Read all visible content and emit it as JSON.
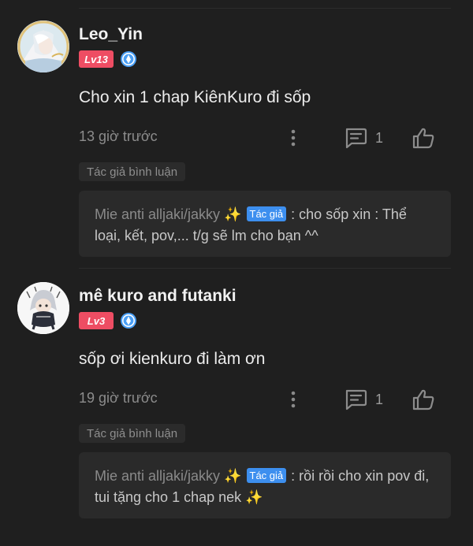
{
  "comments": [
    {
      "username": "Leo_Yin",
      "level": "Lv13",
      "text": "Cho xin 1 chap KiênKuro đi sốp",
      "time": "13 giờ trước",
      "reply_count": "1",
      "author_tag": "Tác giả bình luận",
      "reply": {
        "author": "Mie anti alljaki/jakky",
        "sparkle": "✨",
        "tag": "Tác giả",
        "text": ": cho sốp xin : Thể loại, kết, pov,... t/g sẽ lm cho bạn ^^",
        "trailing": ""
      }
    },
    {
      "username": "mê kuro and futanki",
      "level": "Lv3",
      "text": "sốp ơi kienkuro đi làm ơn",
      "time": "19 giờ trước",
      "reply_count": "1",
      "author_tag": "Tác giả bình luận",
      "reply": {
        "author": "Mie anti alljaki/jakky",
        "sparkle": "✨",
        "tag": "Tác giả",
        "text": ": rồi rồi cho xin pov đi, tui tặng cho 1 chap nek",
        "trailing": "✨"
      }
    }
  ],
  "icons": {
    "more": "more-vertical-icon",
    "reply": "comment-icon",
    "like": "thumbs-up-icon",
    "verify": "verified-badge-icon"
  },
  "colors": {
    "background": "#1f1f1f",
    "level_badge": "#ee4d63",
    "author_tag": "#3d8fef",
    "verify": "#4a9ff5"
  }
}
